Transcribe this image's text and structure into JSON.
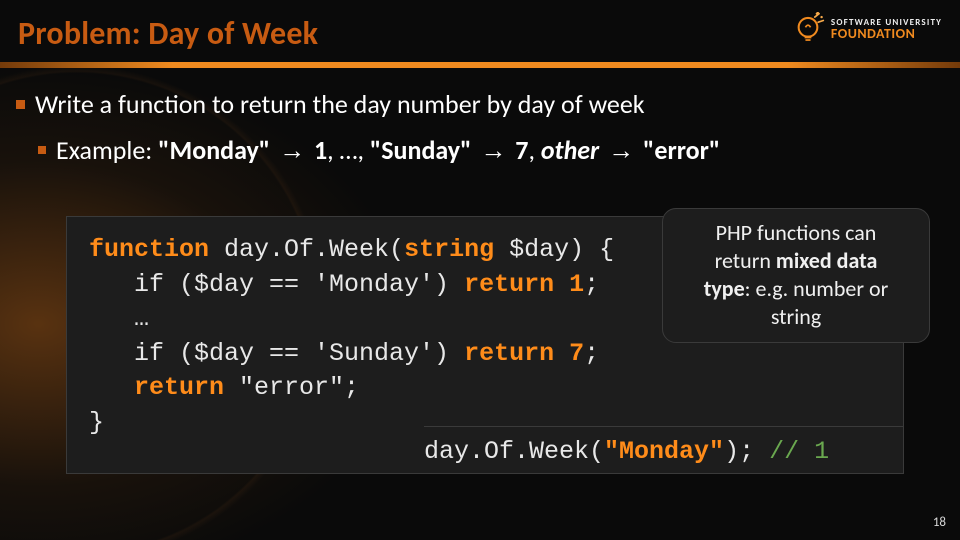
{
  "logo": {
    "line1": "SOFTWARE UNIVERSITY",
    "line2": "FOUNDATION"
  },
  "title": "Problem: Day of Week",
  "bullets": {
    "main": "Write a function to return the day number by day of week",
    "sub_prefix": "Example: ",
    "monday_q": "\"Monday\"",
    "arrow": "→",
    "one": "1",
    "ellipsis": ", …, ",
    "sunday_q": "\"Sunday\"",
    "seven": "7",
    "sep_other": ", ",
    "other": "other",
    "error_q": "\"error\""
  },
  "code": {
    "l1a": "function",
    "l1b": " day.Of.Week(",
    "l1c": "string",
    "l1d": " $day) {",
    "l2a": "   if ($day == 'Monday') ",
    "l2b": "return",
    "l2c": " ",
    "l2d": "1",
    "l2e": ";",
    "l3": "   …",
    "l4a": "   if ($day == 'Sunday') ",
    "l4b": "return",
    "l4c": " ",
    "l4d": "7",
    "l4e": ";",
    "l5a": "   ",
    "l5b": "return",
    "l5c": " \"error\";",
    "l6": "}"
  },
  "call": {
    "fn": "day.Of.Week(",
    "arg": "\"Monday\"",
    "after": "); ",
    "comment": "// 1"
  },
  "note": {
    "l1": "PHP functions can",
    "l2_a": "return ",
    "l2_b": "mixed data",
    "l3_a": "type",
    "l3_b": ": e.g. number or",
    "l4": "string"
  },
  "page": "18"
}
